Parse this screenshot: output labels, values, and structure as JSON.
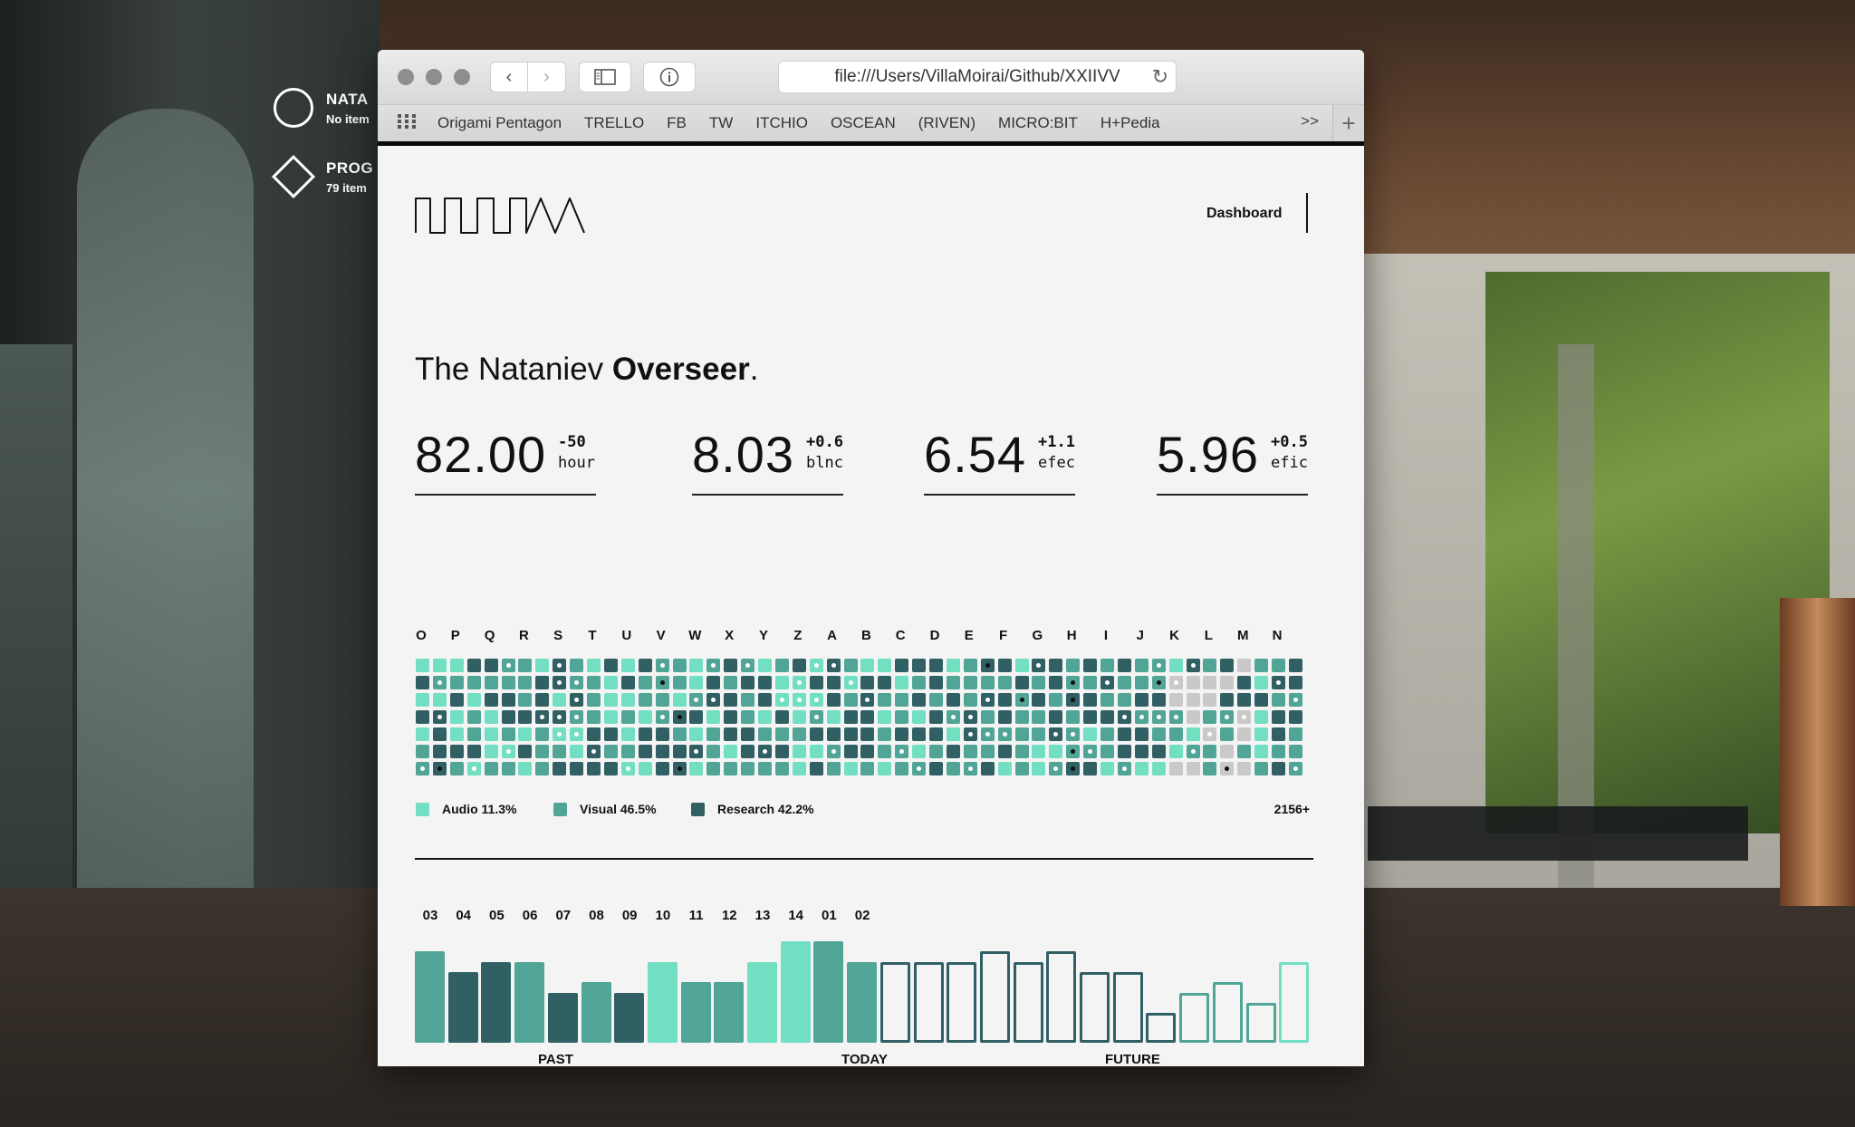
{
  "desktop": {
    "items": [
      {
        "title": "NATA",
        "subtitle": "No item"
      },
      {
        "title": "PROG",
        "subtitle": "79 item"
      }
    ]
  },
  "browser": {
    "url": "file:///Users/VillaMoirai/Github/XXIIVV",
    "bookmarks": [
      "Origami Pentagon",
      "TRELLO",
      "FB",
      "TW",
      "ITCHIO",
      "OSCEAN",
      "(RIVEN)",
      "MICRO:BIT",
      "H+Pedia"
    ],
    "more_label": ">>",
    "new_tab_label": "+"
  },
  "page": {
    "nav_link": "Dashboard",
    "title_regular": "The Nataniev ",
    "title_bold": "Overseer",
    "title_end": ".",
    "stats": [
      {
        "value": "82.00",
        "delta": "-50",
        "unit": "hour"
      },
      {
        "value": "8.03",
        "delta": "+0.6",
        "unit": "blnc"
      },
      {
        "value": "6.54",
        "delta": "+1.1",
        "unit": "efec"
      },
      {
        "value": "5.96",
        "delta": "+0.5",
        "unit": "efic"
      }
    ],
    "grid_letters": [
      "O",
      "P",
      "Q",
      "R",
      "S",
      "T",
      "U",
      "V",
      "W",
      "X",
      "Y",
      "Z",
      "A",
      "B",
      "C",
      "D",
      "E",
      "F",
      "G",
      "H",
      "I",
      "J",
      "K",
      "L",
      "M",
      "N"
    ],
    "legend": [
      {
        "label": "Audio 11.3%",
        "color": "#72dfc2"
      },
      {
        "label": "Visual 46.5%",
        "color": "#51a596"
      },
      {
        "label": "Research 42.2%",
        "color": "#316064"
      }
    ],
    "total": "2156+",
    "bar_labels": [
      "03",
      "04",
      "05",
      "06",
      "07",
      "08",
      "09",
      "10",
      "11",
      "12",
      "13",
      "14",
      "01",
      "02"
    ],
    "phases": [
      "PAST",
      "TODAY",
      "FUTURE"
    ]
  },
  "colors": {
    "audio": "#72dfc2",
    "visual": "#51a596",
    "research": "#316064",
    "empty": "#c9c9c9"
  },
  "chart_data": {
    "type": "bar",
    "ylim": [
      0,
      9
    ],
    "past": [
      {
        "value": 8,
        "cat": "visual"
      },
      {
        "value": 6,
        "cat": "research"
      },
      {
        "value": 7,
        "cat": "research"
      },
      {
        "value": 7,
        "cat": "visual"
      },
      {
        "value": 4,
        "cat": "research"
      },
      {
        "value": 5,
        "cat": "visual"
      },
      {
        "value": 4,
        "cat": "research"
      },
      {
        "value": 7,
        "cat": "audio"
      },
      {
        "value": 5,
        "cat": "visual"
      },
      {
        "value": 5,
        "cat": "visual"
      },
      {
        "value": 7,
        "cat": "audio"
      },
      {
        "value": 9,
        "cat": "audio"
      },
      {
        "value": 9,
        "cat": "visual"
      },
      {
        "value": 7,
        "cat": "visual"
      }
    ],
    "future": [
      {
        "value": 7,
        "cat": "research"
      },
      {
        "value": 7,
        "cat": "research"
      },
      {
        "value": 7,
        "cat": "research"
      },
      {
        "value": 8,
        "cat": "research"
      },
      {
        "value": 7,
        "cat": "research"
      },
      {
        "value": 8,
        "cat": "research"
      },
      {
        "value": 6,
        "cat": "research"
      },
      {
        "value": 6,
        "cat": "research"
      },
      {
        "value": 2,
        "cat": "research"
      },
      {
        "value": 4,
        "cat": "visual"
      },
      {
        "value": 5,
        "cat": "visual"
      },
      {
        "value": 3,
        "cat": "visual"
      },
      {
        "value": 7,
        "cat": "audio"
      }
    ]
  }
}
